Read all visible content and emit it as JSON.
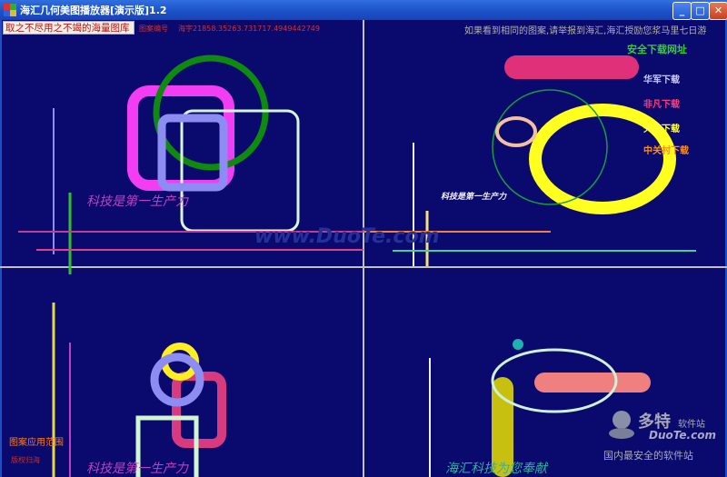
{
  "window": {
    "title": "海汇几何美图播放器[演示版]1.2",
    "buttons": {
      "minimize": "_",
      "maximize": "□",
      "close": "✕"
    }
  },
  "header": {
    "banner": "取之不尽用之不竭的海量图库",
    "pattern_label": "图案编号",
    "pattern_value": "海宇21858.35263.731717.4949442749",
    "notice": "如果看到相同的图案,请举报到海汇,海汇授励您浆马里七日游"
  },
  "download_links": {
    "heading": "安全下载网址",
    "items": [
      {
        "label": "华军下载",
        "color": "#c8c8ff"
      },
      {
        "label": "非凡下载",
        "color": "#ff3b7a"
      },
      {
        "label": "天空下载",
        "color": "#ffff40"
      },
      {
        "label": "中关村下载",
        "color": "#ff8c1a"
      }
    ]
  },
  "panels": {
    "top_left_caption": "科技是第一生产力",
    "top_right_caption": "科技是第一生产力",
    "bottom_left_caption": "科技是第一生产力",
    "bottom_right_caption": "海汇科技为您奉献",
    "application_scope": "图案应用范围",
    "copyright": "版权归海"
  },
  "watermark": "www.DuoTe.com",
  "logo": {
    "brand": "多特",
    "suffix": "软件站",
    "url": "DuoTe.com",
    "tagline": "国内最安全的软件站"
  }
}
